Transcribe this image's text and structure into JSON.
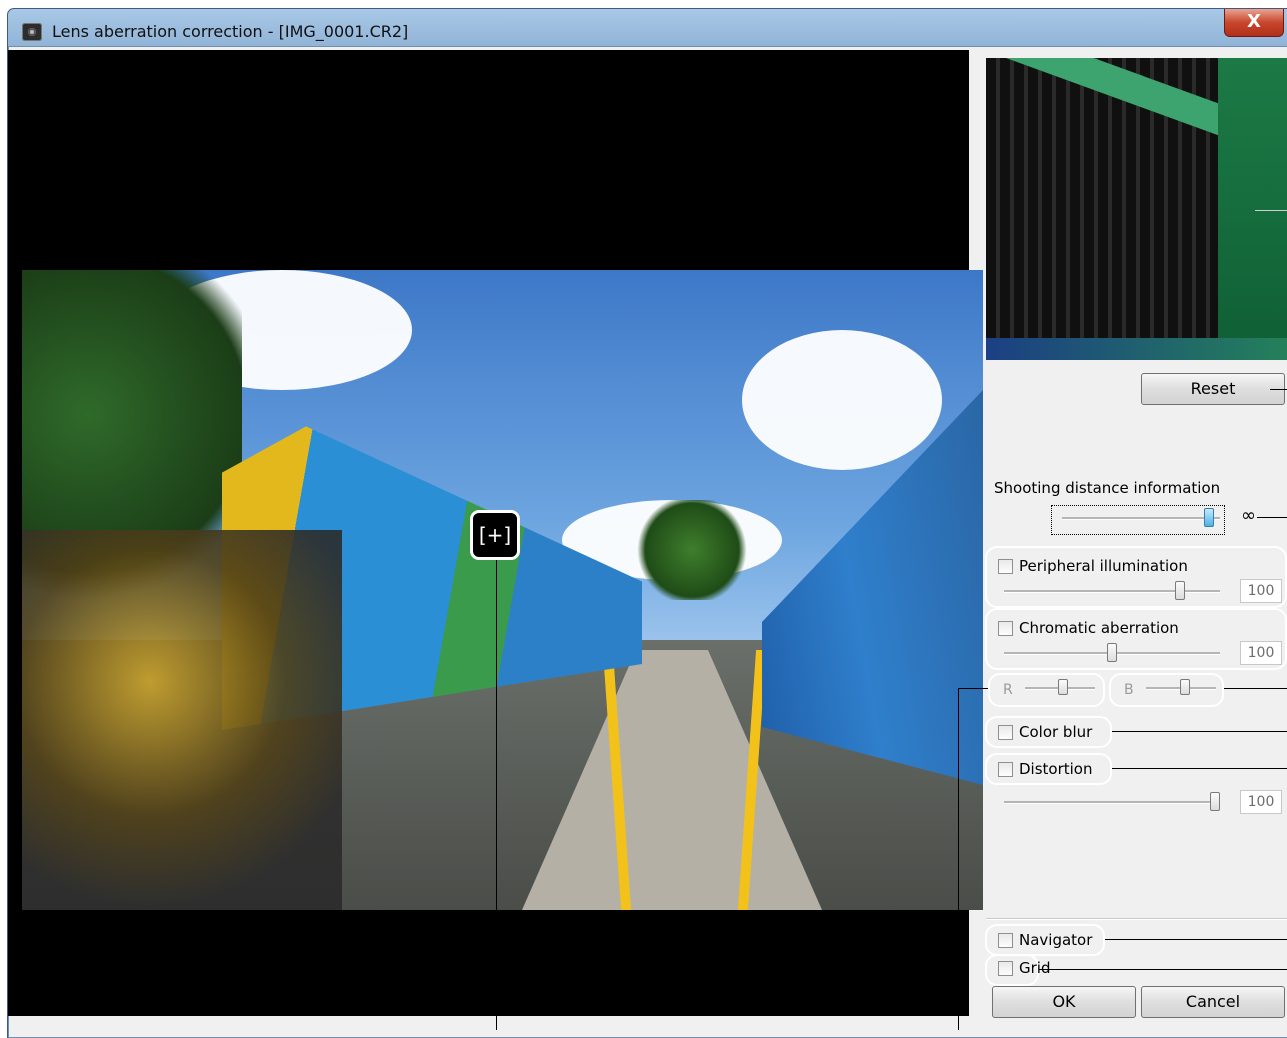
{
  "window": {
    "title": "Lens aberration correction - [IMG_0001.CR2]",
    "close_glyph": "X"
  },
  "preview": {
    "loupe_glyph": "[+]"
  },
  "panel": {
    "reset_label": "Reset",
    "shooting_distance": {
      "label": "Shooting distance information",
      "infinity_glyph": "∞",
      "level": 0.95
    },
    "peripheral_illumination": {
      "label": "Peripheral illumination",
      "checked": false,
      "value": "100"
    },
    "chromatic_aberration": {
      "label": "Chromatic aberration",
      "checked": false,
      "value": "100",
      "r_label": "R",
      "b_label": "B"
    },
    "color_blur": {
      "label": "Color blur",
      "checked": false
    },
    "distortion": {
      "label": "Distortion",
      "checked": false,
      "value": "100"
    },
    "navigator": {
      "label": "Navigator",
      "checked": false
    },
    "grid": {
      "label": "Grid",
      "checked": false
    },
    "ok_label": "OK",
    "cancel_label": "Cancel"
  },
  "colors": {
    "titlebar": "#a9c8e6",
    "close_button": "#c8462c",
    "dialog_bg": "#f0f0f0",
    "active_thumb": "#4bb1e6"
  }
}
